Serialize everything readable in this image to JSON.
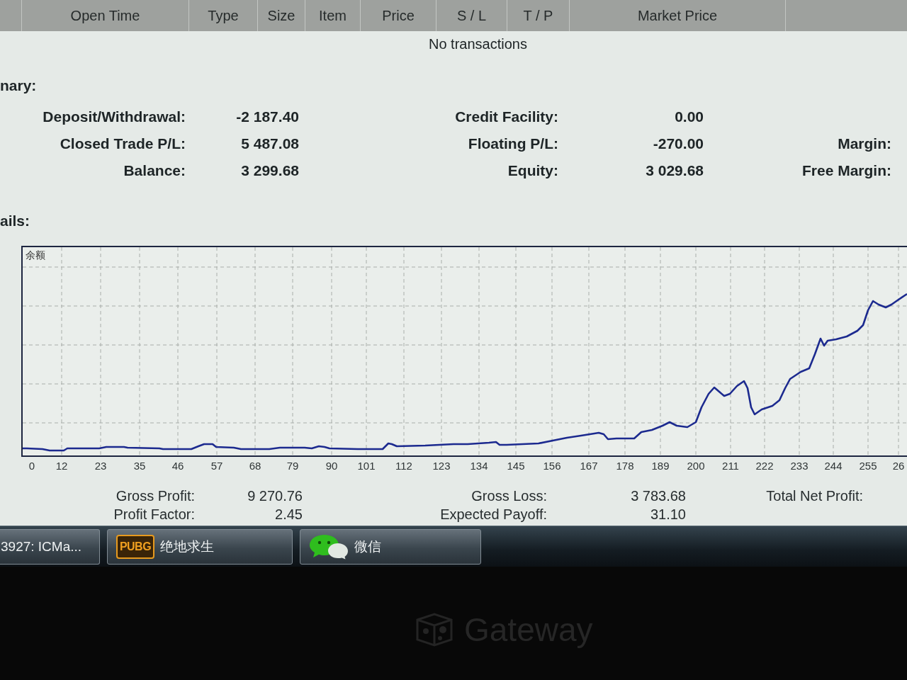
{
  "table": {
    "columns": [
      "Open Time",
      "Type",
      "Size",
      "Item",
      "Price",
      "S / L",
      "T / P",
      "Market Price"
    ],
    "empty_message": "No transactions"
  },
  "summary": {
    "heading": "nary:",
    "rows": [
      [
        {
          "label": "Deposit/Withdrawal:",
          "value": "-2 187.40"
        },
        {
          "label": "Credit Facility:",
          "value": "0.00"
        }
      ],
      [
        {
          "label": "Closed Trade P/L:",
          "value": "5 487.08"
        },
        {
          "label": "Floating P/L:",
          "value": "-270.00"
        },
        {
          "label": "Margin:"
        }
      ],
      [
        {
          "label": "Balance:",
          "value": "3 299.68"
        },
        {
          "label": "Equity:",
          "value": "3 029.68"
        },
        {
          "label": "Free Margin:"
        }
      ]
    ]
  },
  "details": {
    "heading": "ails:",
    "chart": {
      "title": "余额",
      "x_labels": [
        "0",
        "12",
        "23",
        "35",
        "46",
        "57",
        "68",
        "79",
        "90",
        "101",
        "112",
        "123",
        "134",
        "145",
        "156",
        "167",
        "178",
        "189",
        "200",
        "211",
        "222",
        "233",
        "244",
        "255",
        "26"
      ]
    },
    "rows": [
      [
        {
          "label": "Gross Profit:",
          "value": "9 270.76"
        },
        {
          "label": "Gross Loss:",
          "value": "3 783.68"
        },
        {
          "label": "Total Net Profit:"
        }
      ],
      [
        {
          "label": "Profit Factor:",
          "value": "2.45"
        },
        {
          "label": "Expected Payoff:",
          "value": "31.10"
        }
      ]
    ]
  },
  "taskbar": {
    "buttons": [
      {
        "kind": "plain",
        "label": "3927: ICMa..."
      },
      {
        "kind": "tile",
        "icon_text": "PUBG",
        "label": "绝地求生"
      },
      {
        "kind": "bubbles",
        "label": "微信"
      }
    ]
  },
  "monitor": {
    "brand": "Gateway"
  }
}
